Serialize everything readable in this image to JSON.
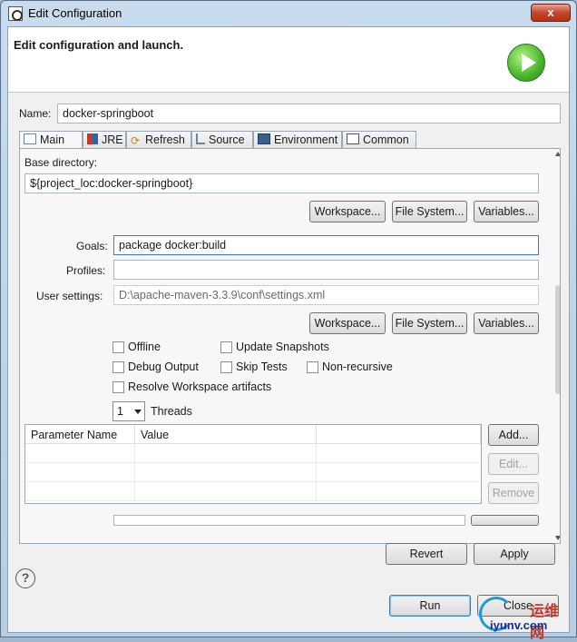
{
  "window": {
    "title": "Edit Configuration",
    "close": "x"
  },
  "header": {
    "title": "Edit configuration and launch."
  },
  "name": {
    "label": "Name:",
    "value": "docker-springboot"
  },
  "tabs": [
    {
      "label": "Main",
      "icon": "page-icon"
    },
    {
      "label": "JRE",
      "icon": "jre-icon"
    },
    {
      "label": "Refresh",
      "icon": "refresh-icon"
    },
    {
      "label": "Source",
      "icon": "source-icon"
    },
    {
      "label": "Environment",
      "icon": "environment-icon"
    },
    {
      "label": "Common",
      "icon": "common-icon"
    }
  ],
  "main": {
    "base_label": "Base directory:",
    "base_value": "${project_loc:docker-springboot}",
    "buttons1": {
      "workspace": "Workspace...",
      "filesystem": "File System...",
      "variables": "Variables..."
    },
    "goals_label": "Goals:",
    "goals_value": "package docker:build",
    "profiles_label": "Profiles:",
    "profiles_value": "",
    "settings_label": "User settings:",
    "settings_value": "D:\\apache-maven-3.3.9\\conf\\settings.xml",
    "buttons2": {
      "workspace": "Workspace...",
      "filesystem": "File System...",
      "variables": "Variables..."
    },
    "options": {
      "offline": "Offline",
      "update_snapshots": "Update Snapshots",
      "debug_output": "Debug Output",
      "skip_tests": "Skip Tests",
      "non_recursive": "Non-recursive",
      "resolve_workspace": "Resolve Workspace artifacts"
    },
    "threads_value": "1",
    "threads_label": "Threads",
    "table": {
      "headers": [
        "Parameter Name",
        "Value"
      ]
    },
    "table_buttons": {
      "add": "Add...",
      "edit": "Edit...",
      "remove": "Remove"
    }
  },
  "footer": {
    "revert": "Revert",
    "apply": "Apply",
    "run": "Run",
    "close": "Close",
    "help": "?"
  },
  "watermark": {
    "top": "运维网",
    "bottom": "iyunv.com"
  }
}
